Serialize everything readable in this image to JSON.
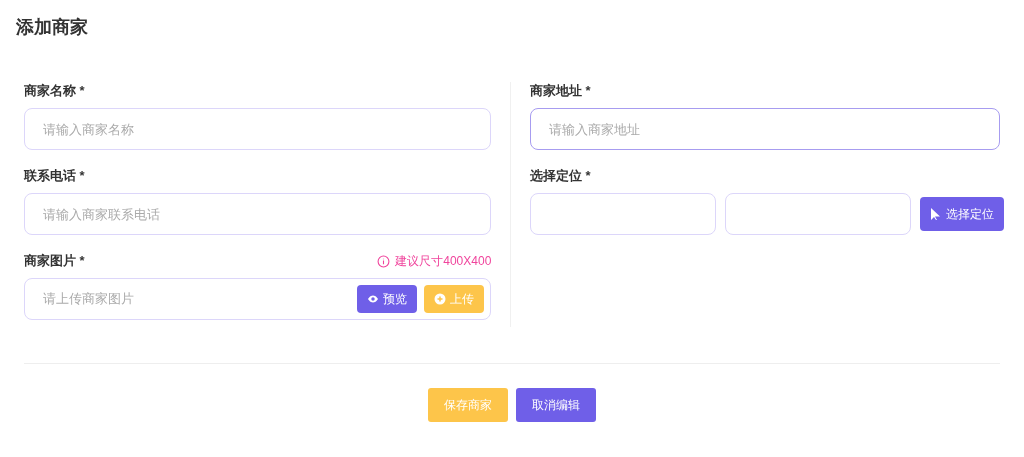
{
  "title": "添加商家",
  "left_fields": [
    {
      "kind": "text",
      "label": "商家名称 *",
      "placeholder": "请输入商家名称",
      "focused": false
    },
    {
      "kind": "text",
      "label": "联系电话 *",
      "placeholder": "请输入商家联系电话",
      "focused": false
    },
    {
      "kind": "image",
      "label": "商家图片 *",
      "placeholder": "请上传商家图片",
      "focused": false,
      "hint": "建议尺寸400X400",
      "buttons": [
        {
          "kind": "preview",
          "label": "预览"
        },
        {
          "kind": "upload",
          "label": "上传"
        }
      ]
    }
  ],
  "right_fields": [
    {
      "kind": "text",
      "label": "商家地址 *",
      "placeholder": "请输入商家地址",
      "focused": true
    },
    {
      "kind": "location",
      "label": "选择定位 *",
      "focused": false,
      "button": "选择定位"
    }
  ],
  "actions": [
    {
      "kind": "save",
      "label": "保存商家"
    },
    {
      "kind": "cancel",
      "label": "取消编辑"
    }
  ]
}
